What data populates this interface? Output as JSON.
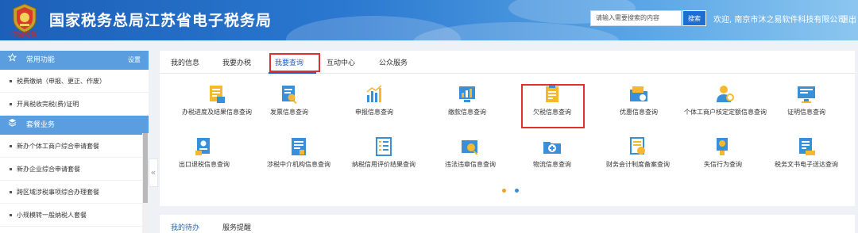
{
  "header": {
    "site_title": "国家税务总局江苏省电子税务局",
    "emblem_caption": "中国税务",
    "search_placeholder": "请输入需要搜索的内容",
    "search_button": "搜索",
    "welcome_text": "欢迎, 南京市沐之易软件科技有限公司",
    "separator": "|",
    "logout": "退出"
  },
  "sidebar": {
    "common_title": "常用功能",
    "settings": "设置",
    "common_items": [
      "税费缴纳（申报、更正、作废）",
      "开具税收完税(费)证明"
    ],
    "package_title": "套餐业务",
    "package_items": [
      "新办个体工商户综合申请套餐",
      "新办企业综合申请套餐",
      "跨区域涉税事项综合办理套餐",
      "小规模转一般纳税人套餐"
    ],
    "collapse_glyph": "«"
  },
  "tabs": [
    "我的信息",
    "我要办税",
    "我要查询",
    "互动中心",
    "公众服务"
  ],
  "active_tab": "我要查询",
  "services_row1": [
    {
      "label": "办税进度及结果信息查询",
      "icon": "document-progress-icon"
    },
    {
      "label": "发票信息查询",
      "icon": "invoice-search-icon"
    },
    {
      "label": "申报信息查询",
      "icon": "declaration-chart-icon"
    },
    {
      "label": "缴款信息查询",
      "icon": "payment-chart-icon"
    },
    {
      "label": "欠税信息查询",
      "icon": "tax-arrears-icon"
    },
    {
      "label": "优惠信息查询",
      "icon": "discount-folder-icon"
    },
    {
      "label": "个体工商户核定定额信息查询",
      "icon": "person-audit-icon"
    },
    {
      "label": "证明信息查询",
      "icon": "certificate-monitor-icon"
    }
  ],
  "services_row2": [
    {
      "label": "出口退税信息查询",
      "icon": "export-refund-icon"
    },
    {
      "label": "涉税中介机构信息查询",
      "icon": "agency-document-icon"
    },
    {
      "label": "纳税信用评价结果查询",
      "icon": "credit-list-icon"
    },
    {
      "label": "违法违章信息查询",
      "icon": "violation-search-icon"
    },
    {
      "label": "物流信息查询",
      "icon": "logistics-plus-icon"
    },
    {
      "label": "财务会计制度备案查询",
      "icon": "accounting-record-icon"
    },
    {
      "label": "失信行为查询",
      "icon": "dishonesty-badge-icon"
    },
    {
      "label": "税务文书电子送达查询",
      "icon": "e-document-delivery-icon"
    }
  ],
  "pager": {
    "active_color": "#f0a030",
    "inactive_color": "#3a8fd9"
  },
  "bottom_tabs": [
    "我的待办",
    "服务提醒"
  ],
  "colors": {
    "brand_blue": "#1b66c9",
    "highlight_red": "#e03030",
    "sidebar_header": "#5a9ee0"
  }
}
